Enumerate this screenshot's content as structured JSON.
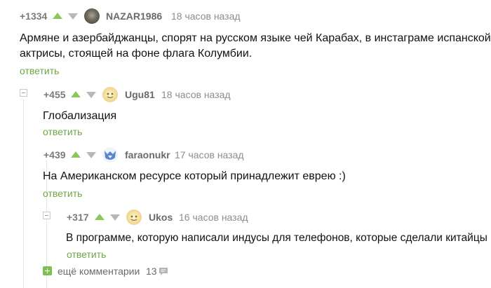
{
  "colors": {
    "accent": "#6ba845",
    "vote_up": "#8ac858",
    "vote_down": "#b8b8b8"
  },
  "comments": [
    {
      "rating": "+1334",
      "author": "NAZAR1986",
      "time": "18 часов назад",
      "text_lines": [
        "Армяне и азербайджанцы, спорят на русском языке чей Карабах, в инстаграме испанской",
        "актрисы, стоящей на фоне флага Колумбии."
      ],
      "reply": "ответить"
    },
    {
      "rating": "+455",
      "author": "Ugu81",
      "time": "18 часов назад",
      "text_lines": [
        "Глобализация"
      ],
      "reply": "ответить"
    },
    {
      "rating": "+439",
      "author": "faraonukr",
      "time": "17 часов назад",
      "text_lines": [
        "На Американском ресурсе который принадлежит еврею :)"
      ],
      "reply": "ответить"
    },
    {
      "rating": "+317",
      "author": "Ukos",
      "time": "16 часов назад",
      "text_lines": [
        "В программе, которую написали индусы для телефонов, которые сделали китайцы"
      ],
      "reply": "ответить"
    }
  ],
  "more_comments": {
    "label": "ещё комментарии",
    "count": "13",
    "icons": [
      "plus-icon",
      "comment-bubble-icon"
    ]
  }
}
